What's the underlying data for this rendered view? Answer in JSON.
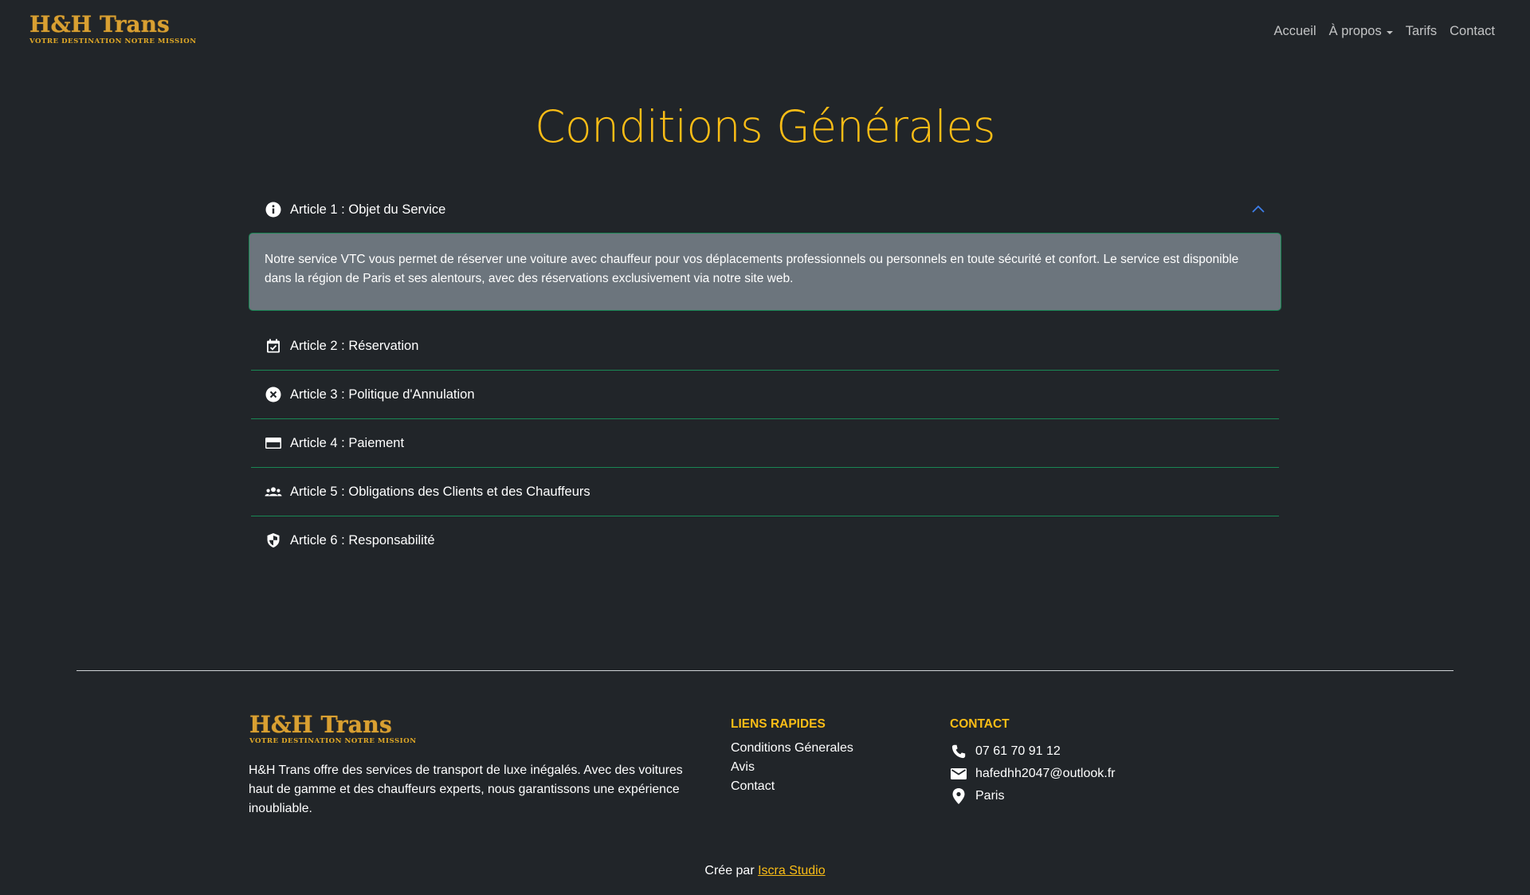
{
  "navbar": {
    "brand": {
      "title": "H&H Trans",
      "tagline": "VOTRE DESTINATION NOTRE MISSION"
    },
    "links": [
      {
        "label": "Accueil"
      },
      {
        "label": "À propos",
        "dropdown": true
      },
      {
        "label": "Tarifs"
      },
      {
        "label": "Contact"
      }
    ]
  },
  "page": {
    "title": "Conditions Générales"
  },
  "accordion": {
    "items": [
      {
        "label": "Article 1 : Objet du Service",
        "icon": "info-icon",
        "expanded": true,
        "body": "Notre service VTC vous permet de réserver une voiture avec chauffeur pour vos déplacements professionnels ou personnels en toute sécurité et confort. Le service est disponible dans la région de Paris et ses alentours, avec des réservations exclusivement via notre site web."
      },
      {
        "label": "Article 2 : Réservation",
        "icon": "calendar-check-icon",
        "expanded": false
      },
      {
        "label": "Article 3 : Politique d'Annulation",
        "icon": "cancel-circle-icon",
        "expanded": false
      },
      {
        "label": "Article 4 : Paiement",
        "icon": "credit-card-icon",
        "expanded": false
      },
      {
        "label": "Article 5 : Obligations des Clients et des Chauffeurs",
        "icon": "people-icon",
        "expanded": false
      },
      {
        "label": "Article 6 : Responsabilité",
        "icon": "shield-icon",
        "expanded": false
      }
    ]
  },
  "footer": {
    "brand": {
      "title": "H&H Trans",
      "tagline": "VOTRE DESTINATION NOTRE MISSION"
    },
    "description": "H&H Trans offre des services de transport de luxe inégalés. Avec des voitures haut de gamme et des chauffeurs experts, nous garantissons une expérience inoubliable.",
    "quick_links": {
      "title": "LIENS RAPIDES",
      "items": [
        "Conditions Génerales",
        "Avis",
        "Contact"
      ]
    },
    "contact": {
      "title": "CONTACT",
      "phone": "07 61 70 91 12",
      "email": "hafedhh2047@outlook.fr",
      "location": "Paris"
    },
    "credits": {
      "prefix": "Crée par",
      "link": "Iscra Studio"
    }
  },
  "colors": {
    "background": "#212529",
    "accent": "#fbbd16",
    "divider": "#198754",
    "panel": "#6c757d"
  }
}
